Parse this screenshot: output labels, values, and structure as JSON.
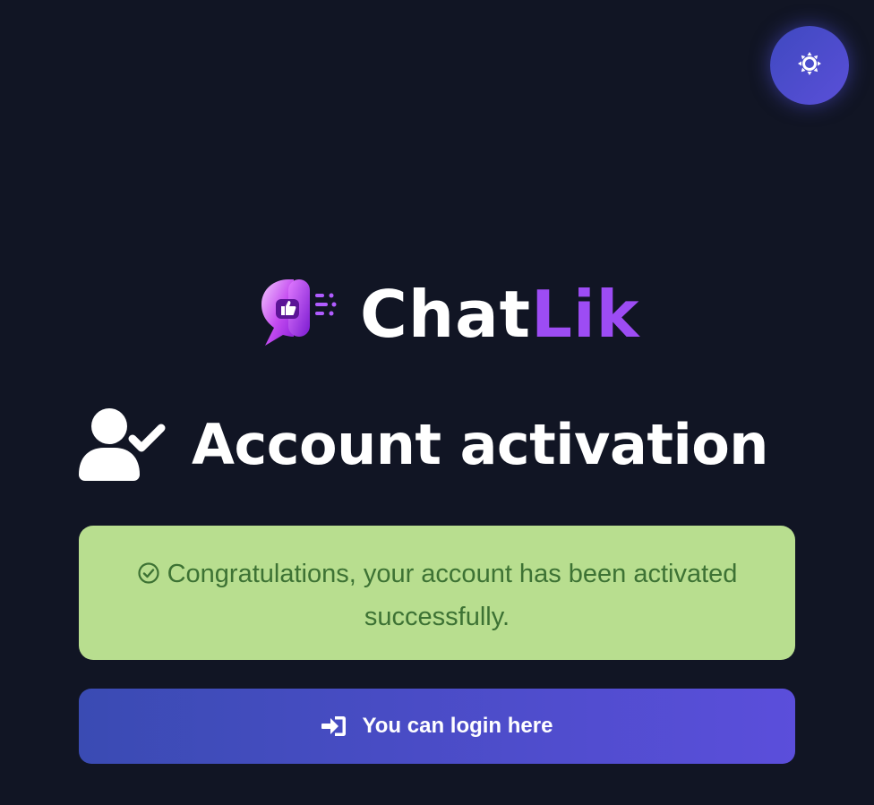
{
  "theme_toggle": {
    "icon": "sun-icon"
  },
  "brand": {
    "name_part1": "Chat",
    "name_part2": "Lik",
    "logo_icon": "chat-bubble-thumbs-up-icon",
    "colors": {
      "accent": "#9d4cf4",
      "text": "#ffffff"
    }
  },
  "page": {
    "title": "Account activation",
    "title_icon": "user-check-icon"
  },
  "alert": {
    "icon": "check-circle-icon",
    "message": "Congratulations, your account has been activated successfully.",
    "colors": {
      "background": "#b8de8f",
      "text": "#3d7234"
    }
  },
  "login_button": {
    "label": "You can login here",
    "icon": "sign-in-icon"
  },
  "colors": {
    "background": "#111524",
    "button_gradient_start": "#3a4bb3",
    "button_gradient_end": "#5b4edb"
  }
}
